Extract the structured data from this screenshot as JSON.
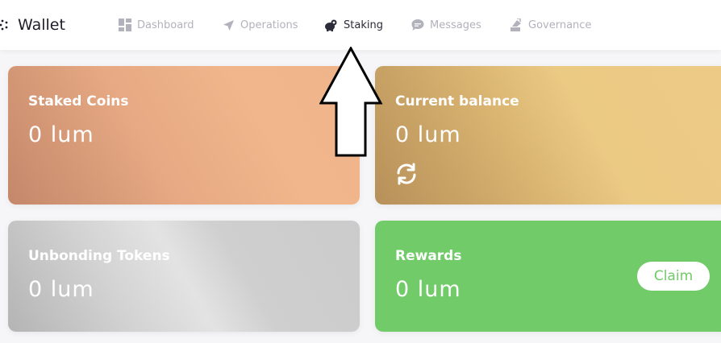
{
  "app": {
    "title": "Wallet"
  },
  "nav": {
    "items": [
      {
        "label": "Dashboard",
        "icon": "dashboard-icon"
      },
      {
        "label": "Operations",
        "icon": "send-icon"
      },
      {
        "label": "Staking",
        "icon": "piggy-bank-icon",
        "active": true
      },
      {
        "label": "Messages",
        "icon": "chat-icon"
      },
      {
        "label": "Governance",
        "icon": "governance-icon"
      }
    ]
  },
  "cards": {
    "staked": {
      "title": "Staked Coins",
      "value": "0 lum"
    },
    "balance": {
      "title": "Current balance",
      "value": "0 lum",
      "icon": "refresh-icon"
    },
    "unbonding": {
      "title": "Unbonding Tokens",
      "value": "0 lum"
    },
    "rewards": {
      "title": "Rewards",
      "value": "0 lum",
      "claim_label": "Claim"
    }
  },
  "colors": {
    "accent_green": "#70cb68",
    "nav_inactive": "#b2b2bc",
    "nav_active": "#2c2c3a"
  },
  "annotation": {
    "icon": "up-arrow-icon"
  }
}
